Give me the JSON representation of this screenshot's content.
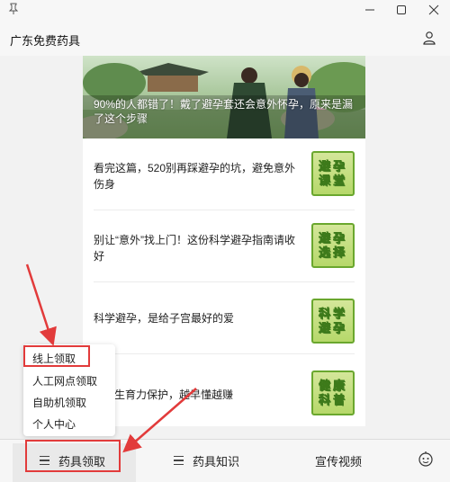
{
  "app": {
    "title": "广东免费药具"
  },
  "window": {
    "pin_icon": "pin-icon",
    "minimize_icon": "minimize-icon",
    "maximize_icon": "maximize-icon",
    "close_icon": "close-icon"
  },
  "header": {
    "user_icon": "user-icon"
  },
  "banner": {
    "caption": "90%的人都错了！戴了避孕套还会意外怀孕，原来是漏了这个步骤"
  },
  "articles": [
    {
      "title": "看完这篇，520别再踩避孕的坑，避免意外伤身",
      "thumb_line1": "避孕",
      "thumb_line2": "课堂"
    },
    {
      "title": "别让“意外”找上门！这份科学避孕指南请收好",
      "thumb_line1": "避孕",
      "thumb_line2": "选择"
    },
    {
      "title": "科学避孕，是给子宫最好的爱",
      "thumb_line1": "科学",
      "thumb_line2": "避孕"
    },
    {
      "title": "生育力保护，越早懂越赚",
      "thumb_line1": "健康",
      "thumb_line2": "科普"
    }
  ],
  "popup_menu": {
    "items": [
      "线上领取",
      "人工网点领取",
      "自助机领取",
      "个人中心"
    ]
  },
  "bottom_nav": {
    "tab1": "药具领取",
    "tab2": "药具知识",
    "tab3": "宣传视频",
    "bot_icon": "robot-icon"
  },
  "colors": {
    "annotation_red": "#e23b3b",
    "thumb_green": "#6aa72e"
  }
}
